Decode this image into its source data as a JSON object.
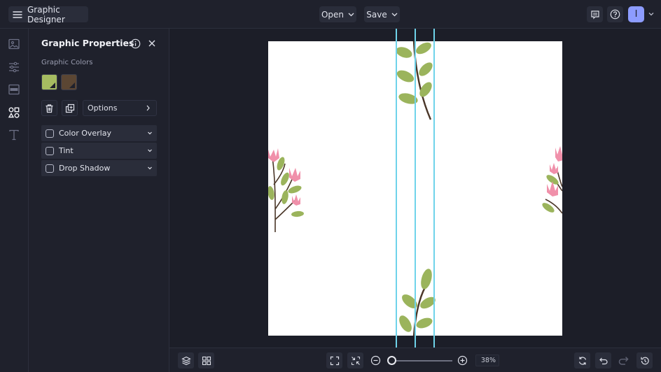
{
  "topbar": {
    "app_title": "Graphic Designer",
    "menu_icon": "hamburger-menu-icon",
    "open_label": "Open",
    "save_label": "Save",
    "comment_icon": "comment-icon",
    "help_icon": "help-icon",
    "avatar_initial": "I"
  },
  "left_rail": {
    "items": [
      {
        "name": "image-icon",
        "active": false
      },
      {
        "name": "adjustments-icon",
        "active": false
      },
      {
        "name": "layout-icon",
        "active": false
      },
      {
        "name": "graphics-icon",
        "active": true
      },
      {
        "name": "text-icon",
        "active": false
      }
    ]
  },
  "panel": {
    "title": "Graphic Properties",
    "colors_label": "Graphic Colors",
    "colors": [
      "#a6bc61",
      "#5b4633"
    ],
    "options_label": "Options",
    "accordions": [
      {
        "label": "Color Overlay",
        "checked": false
      },
      {
        "label": "Tint",
        "checked": false
      },
      {
        "label": "Drop Shadow",
        "checked": false
      }
    ]
  },
  "bottombar": {
    "zoom_value": "38%",
    "zoom_fraction": 0.05
  },
  "colors": {
    "leaf": "#9bb45c",
    "petal": "#f090aa",
    "stem": "#4a3628",
    "guide": "#6fd3ea",
    "accent": "#8d9cff"
  }
}
